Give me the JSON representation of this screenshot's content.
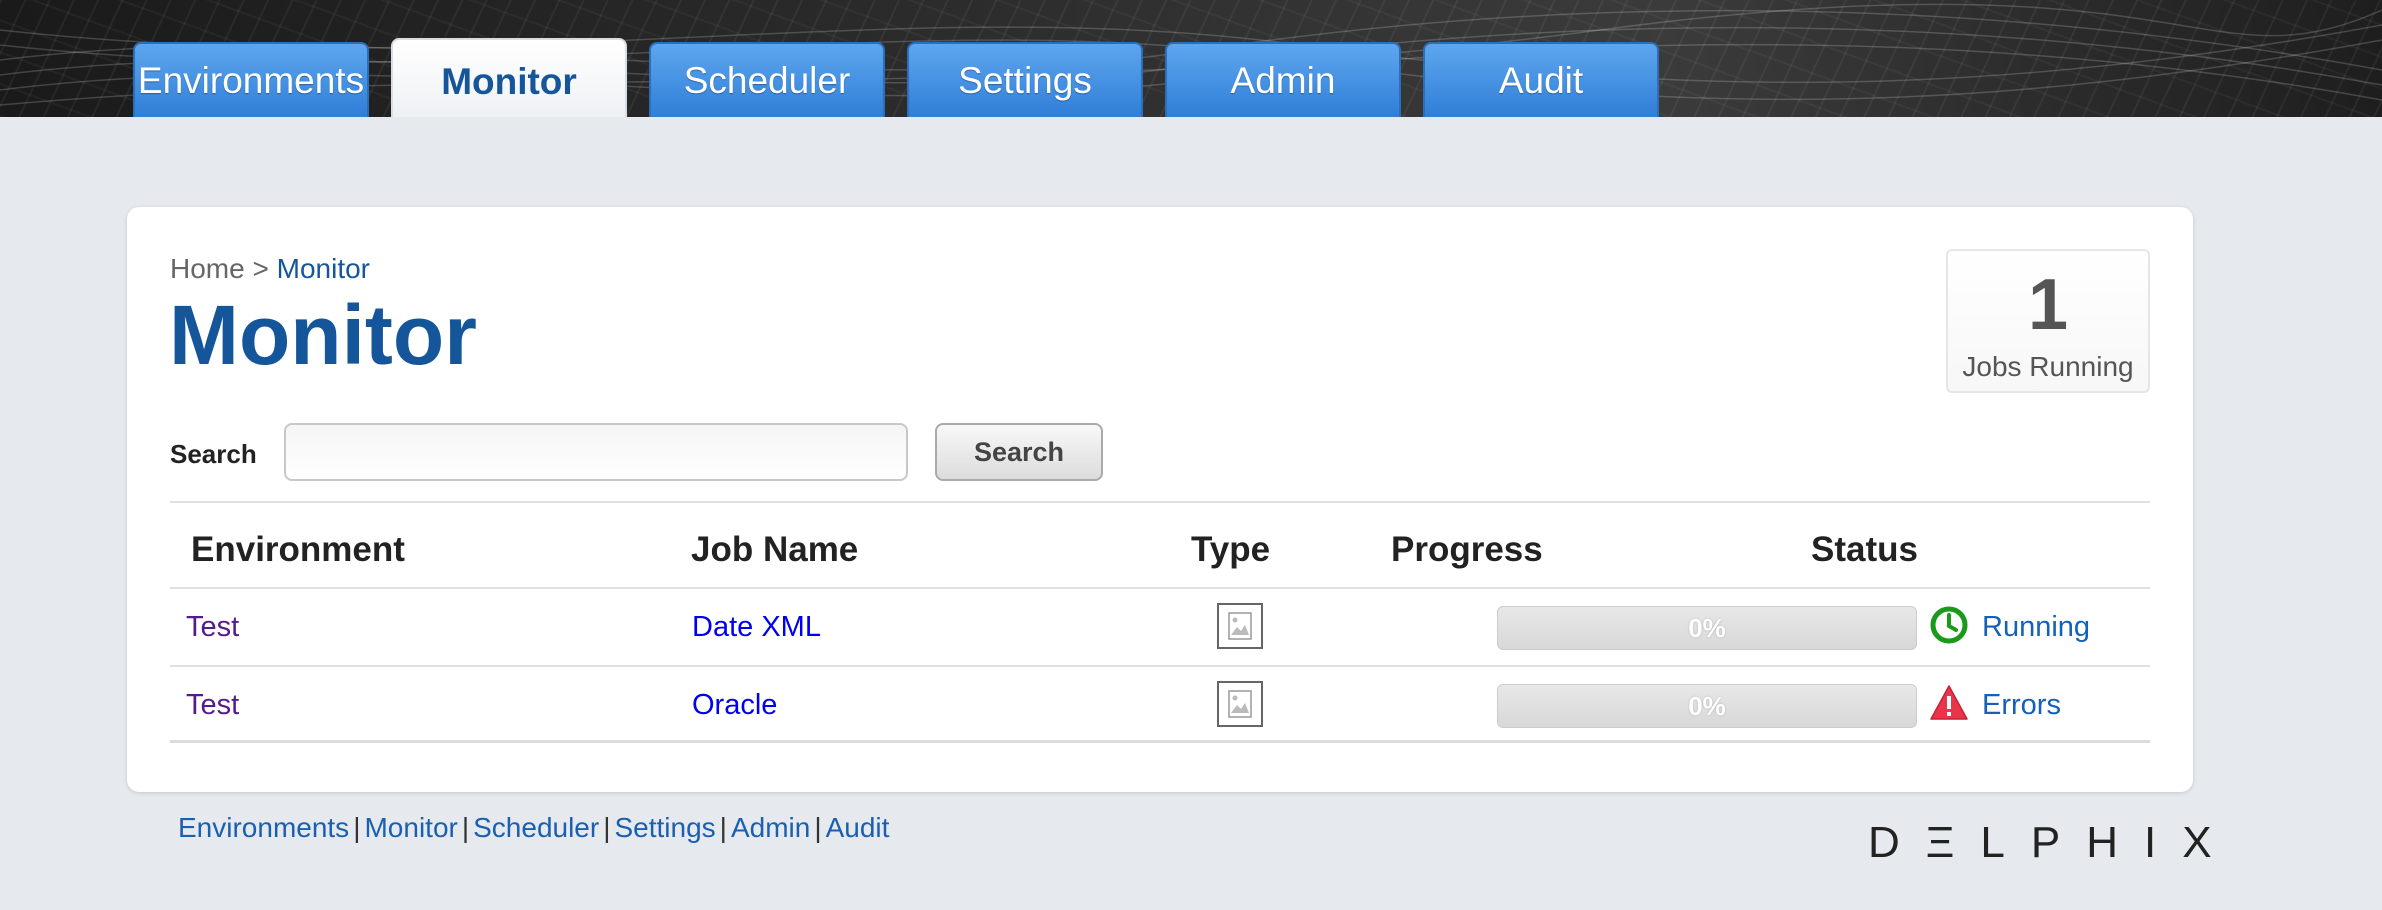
{
  "nav": {
    "tabs": [
      {
        "label": "Environments"
      },
      {
        "label": "Monitor"
      },
      {
        "label": "Scheduler"
      },
      {
        "label": "Settings"
      },
      {
        "label": "Admin"
      },
      {
        "label": "Audit"
      }
    ],
    "active_tab": "Monitor"
  },
  "breadcrumb": {
    "home": "Home",
    "separator": ">",
    "current": "Monitor"
  },
  "page": {
    "title": "Monitor"
  },
  "jobs": {
    "count": "1",
    "label": "Jobs Running"
  },
  "search": {
    "label": "Search",
    "value": "",
    "button": "Search"
  },
  "table": {
    "headers": {
      "environment": "Environment",
      "job_name": "Job Name",
      "type": "Type",
      "progress": "Progress",
      "status": "Status"
    },
    "rows": [
      {
        "environment": "Test",
        "job_name": "Date XML",
        "type_icon": "image-icon",
        "progress": "0%",
        "status": "Running",
        "status_icon": "clock-icon"
      },
      {
        "environment": "Test",
        "job_name": "Oracle",
        "type_icon": "image-icon",
        "progress": "0%",
        "status": "Errors",
        "status_icon": "warning-icon"
      }
    ]
  },
  "footer": {
    "links": [
      "Environments",
      "Monitor",
      "Scheduler",
      "Settings",
      "Admin",
      "Audit"
    ],
    "separator": "|"
  },
  "brand": {
    "logo": "DΞLPHIX"
  },
  "colors": {
    "accent": "#15569a",
    "tab_blue": "#3a8ae0",
    "running": "#1a9a1a",
    "error": "#e8354a"
  }
}
